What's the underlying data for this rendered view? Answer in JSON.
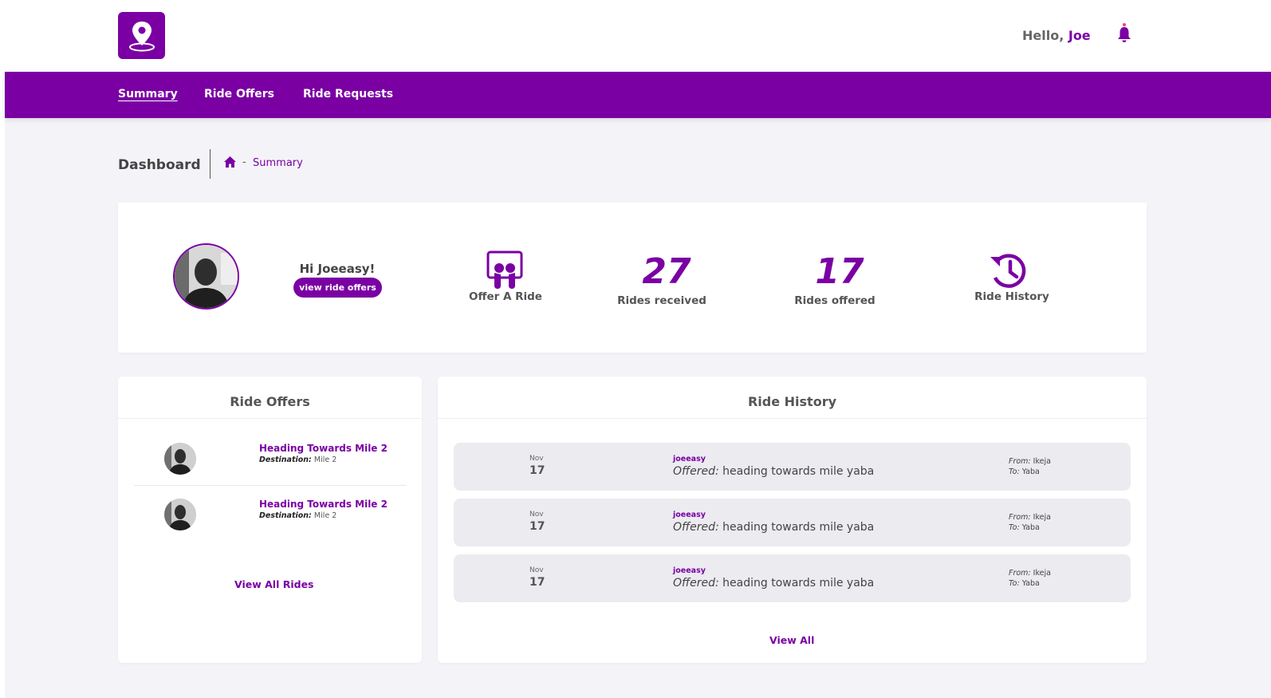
{
  "header": {
    "greeting": "Hello,",
    "user_name": "Joe"
  },
  "nav": {
    "items": [
      {
        "label": "Summary",
        "active": true
      },
      {
        "label": "Ride Offers",
        "active": false
      },
      {
        "label": "Ride Requests",
        "active": false
      }
    ]
  },
  "breadcrumb": {
    "page_title": "Dashboard",
    "separator": "-",
    "current": "Summary"
  },
  "summary": {
    "greeting": "Hi Joeeasy!",
    "view_offers_label": "view ride offers",
    "offer_ride_label": "Offer A Ride",
    "rides_received_count": "27",
    "rides_received_label": "Rides received",
    "rides_offered_count": "17",
    "rides_offered_label": "Rides offered",
    "ride_history_label": "Ride History"
  },
  "ride_offers": {
    "title": "Ride Offers",
    "destination_label": "Destination:",
    "items": [
      {
        "title": "Heading Towards Mile 2",
        "destination": "Mile 2"
      },
      {
        "title": "Heading Towards Mile 2",
        "destination": "Mile 2"
      }
    ],
    "view_all_label": "View All Rides"
  },
  "ride_history": {
    "title": "Ride History",
    "from_label": "From:",
    "to_label": "To:",
    "offered_label": "Offered:",
    "rows": [
      {
        "month": "Nov",
        "day": "17",
        "user": "joeeasy",
        "description": "heading towards mile yaba",
        "from": "Ikeja",
        "to": "Yaba"
      },
      {
        "month": "Nov",
        "day": "17",
        "user": "joeeasy",
        "description": "heading towards mile yaba",
        "from": "Ikeja",
        "to": "Yaba"
      },
      {
        "month": "Nov",
        "day": "17",
        "user": "joeeasy",
        "description": "heading towards mile yaba",
        "from": "Ikeja",
        "to": "Yaba"
      }
    ],
    "view_all_label": "View All"
  },
  "theme": {
    "accent": "#7a00a3",
    "background": "#f4f4f8",
    "row_background": "#ebebf0"
  }
}
